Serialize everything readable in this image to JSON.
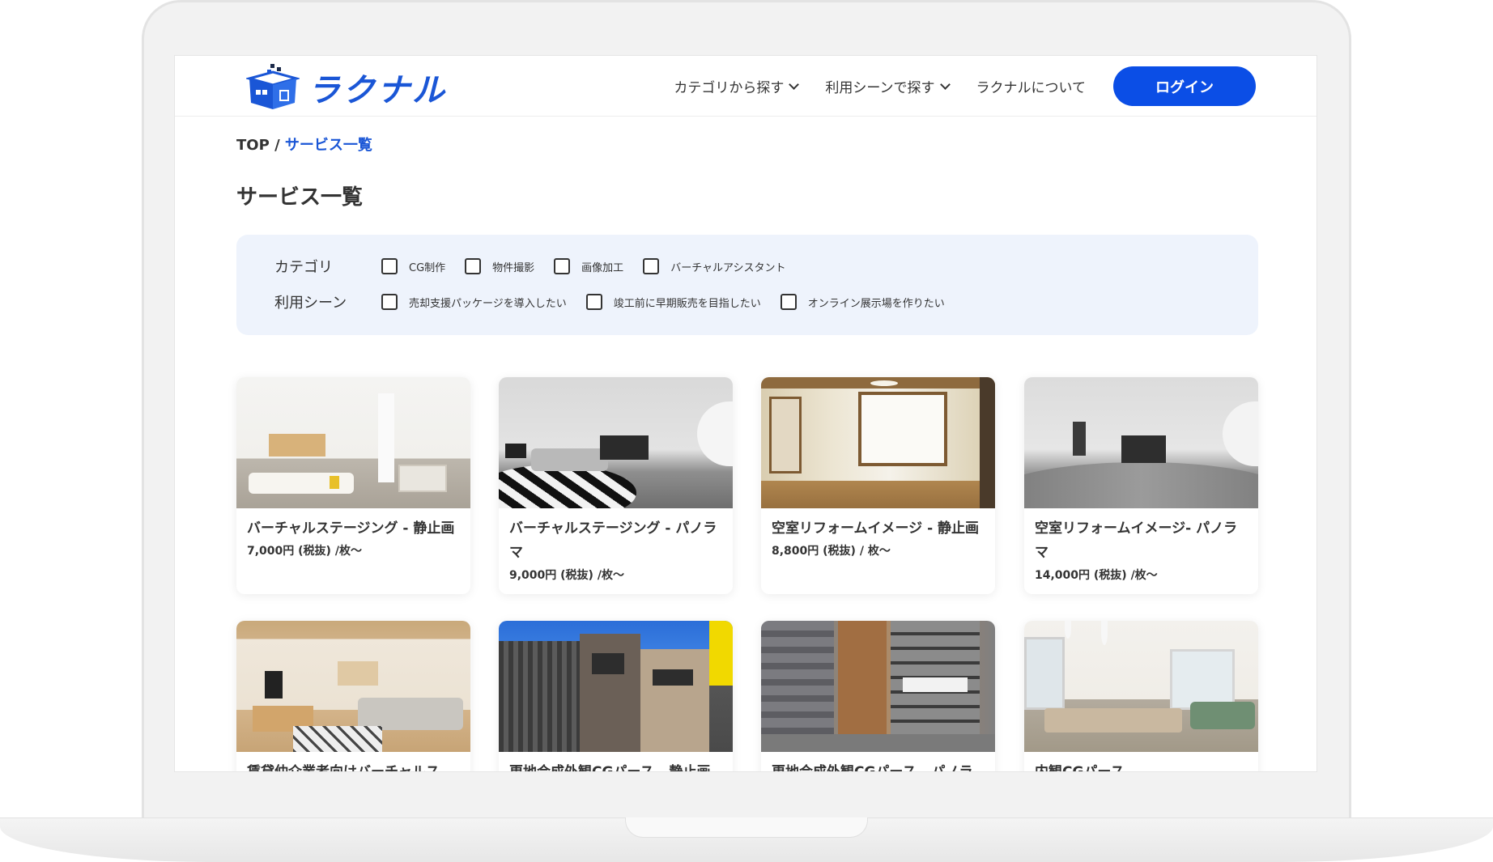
{
  "header": {
    "logo_text": "ラクナル",
    "nav": [
      {
        "label": "カテゴリから探す",
        "dropdown": true
      },
      {
        "label": "利用シーンで探す",
        "dropdown": true
      },
      {
        "label": "ラクナルについて",
        "dropdown": false
      }
    ],
    "login_label": "ログイン",
    "accent_color": "#0b4ee6"
  },
  "breadcrumb": {
    "root": "TOP",
    "separator": "/",
    "current": "サービス一覧"
  },
  "page_title": "サービス一覧",
  "filters": {
    "category": {
      "label": "カテゴリ",
      "options": [
        "CG制作",
        "物件撮影",
        "画像加工",
        "バーチャルアシスタント"
      ]
    },
    "scene": {
      "label": "利用シーン",
      "options": [
        "売却支援パッケージを導入したい",
        "竣工前に早期販売を目指したい",
        "オンライン展示場を作りたい"
      ]
    }
  },
  "cards": [
    {
      "title": "バーチャルステージング - 静止画",
      "price": "7,000円 (税抜) /枚〜"
    },
    {
      "title": "バーチャルステージング - パノラマ",
      "price": "9,000円 (税抜) /枚〜"
    },
    {
      "title": "空室リフォームイメージ - 静止画",
      "price": "8,800円 (税抜) / 枚〜"
    },
    {
      "title": "空室リフォームイメージ- パノラマ",
      "price": "14,000円 (税抜) /枚〜"
    },
    {
      "title": "賃貸仲介業者向けバーチャルス",
      "price": ""
    },
    {
      "title": "更地合成外観CGパース - 静止画",
      "price": ""
    },
    {
      "title": "更地合成外観CGパース - パノラ",
      "price": ""
    },
    {
      "title": "内観CGパース",
      "price": ""
    }
  ]
}
